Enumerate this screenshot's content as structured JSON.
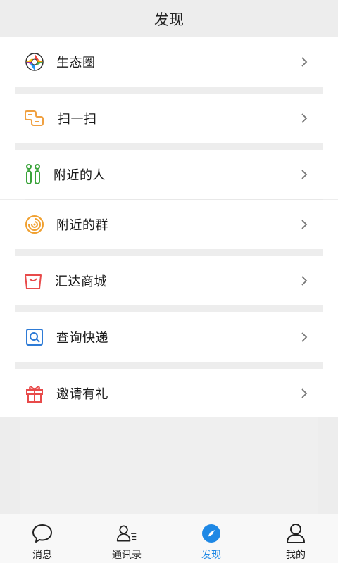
{
  "header": {
    "title": "发现"
  },
  "menu": {
    "moments": {
      "label": "生态圈",
      "icon": "aperture-icon"
    },
    "scan": {
      "label": "扫一扫",
      "icon": "scan-icon"
    },
    "nearby_people": {
      "label": "附近的人",
      "icon": "people-icon"
    },
    "nearby_groups": {
      "label": "附近的群",
      "icon": "radar-icon"
    },
    "mall": {
      "label": "汇达商城",
      "icon": "shopping-bag-icon"
    },
    "express": {
      "label": "查询快递",
      "icon": "search-box-icon"
    },
    "invite": {
      "label": "邀请有礼",
      "icon": "gift-icon"
    }
  },
  "tabbar": {
    "messages": "消息",
    "contacts": "通讯录",
    "discover": "发现",
    "me": "我的",
    "active": "discover"
  },
  "colors": {
    "accent": "#1e88e5",
    "scan": "#f0a040",
    "people": "#3aa33a",
    "radar": "#f0a030",
    "mall": "#e84a4a",
    "express": "#2e7bd6",
    "invite": "#e84a4a"
  }
}
